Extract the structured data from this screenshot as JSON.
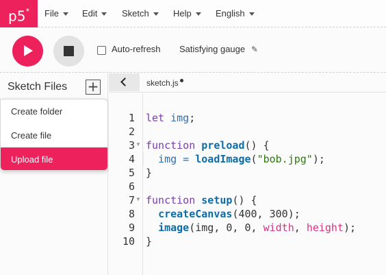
{
  "app": {
    "logo": "p5",
    "logo_sup": "*"
  },
  "menu": [
    {
      "label": "File"
    },
    {
      "label": "Edit"
    },
    {
      "label": "Sketch"
    },
    {
      "label": "Help"
    },
    {
      "label": "English"
    }
  ],
  "toolbar": {
    "auto_refresh_label": "Auto-refresh",
    "auto_refresh_checked": false,
    "sketch_name": "Satisfying gauge",
    "pencil_icon": "✎"
  },
  "sidebar": {
    "title": "Sketch Files",
    "add_label": "+",
    "dropdown": [
      {
        "label": "Create folder"
      },
      {
        "label": "Create file"
      },
      {
        "label": "Upload file"
      }
    ]
  },
  "editor": {
    "tab_name": "sketch.js",
    "line_numbers": [
      "1",
      "2",
      "3",
      "4",
      "5",
      "6",
      "7",
      "8",
      "9",
      "10"
    ],
    "lines": {
      "l1": {
        "a": "let ",
        "b": "img",
        "c": ";"
      },
      "l3": {
        "a": "function ",
        "b": "preload",
        "c": "() {"
      },
      "l4": {
        "a": "  img = ",
        "b": "loadImage",
        "c": "(",
        "d": "\"bob.jpg\"",
        "e": ");"
      },
      "l5": {
        "a": "}"
      },
      "l7": {
        "a": "function ",
        "b": "setup",
        "c": "() {"
      },
      "l8": {
        "a": "  ",
        "b": "createCanvas",
        "c": "(400, 300);"
      },
      "l9": {
        "a": "  ",
        "b": "image",
        "c": "(img, 0, 0, ",
        "d": "width",
        "e": ", ",
        "f": "height",
        "g": ");"
      },
      "l10": {
        "a": "}"
      }
    }
  },
  "colors": {
    "accent": "#ed225d"
  }
}
